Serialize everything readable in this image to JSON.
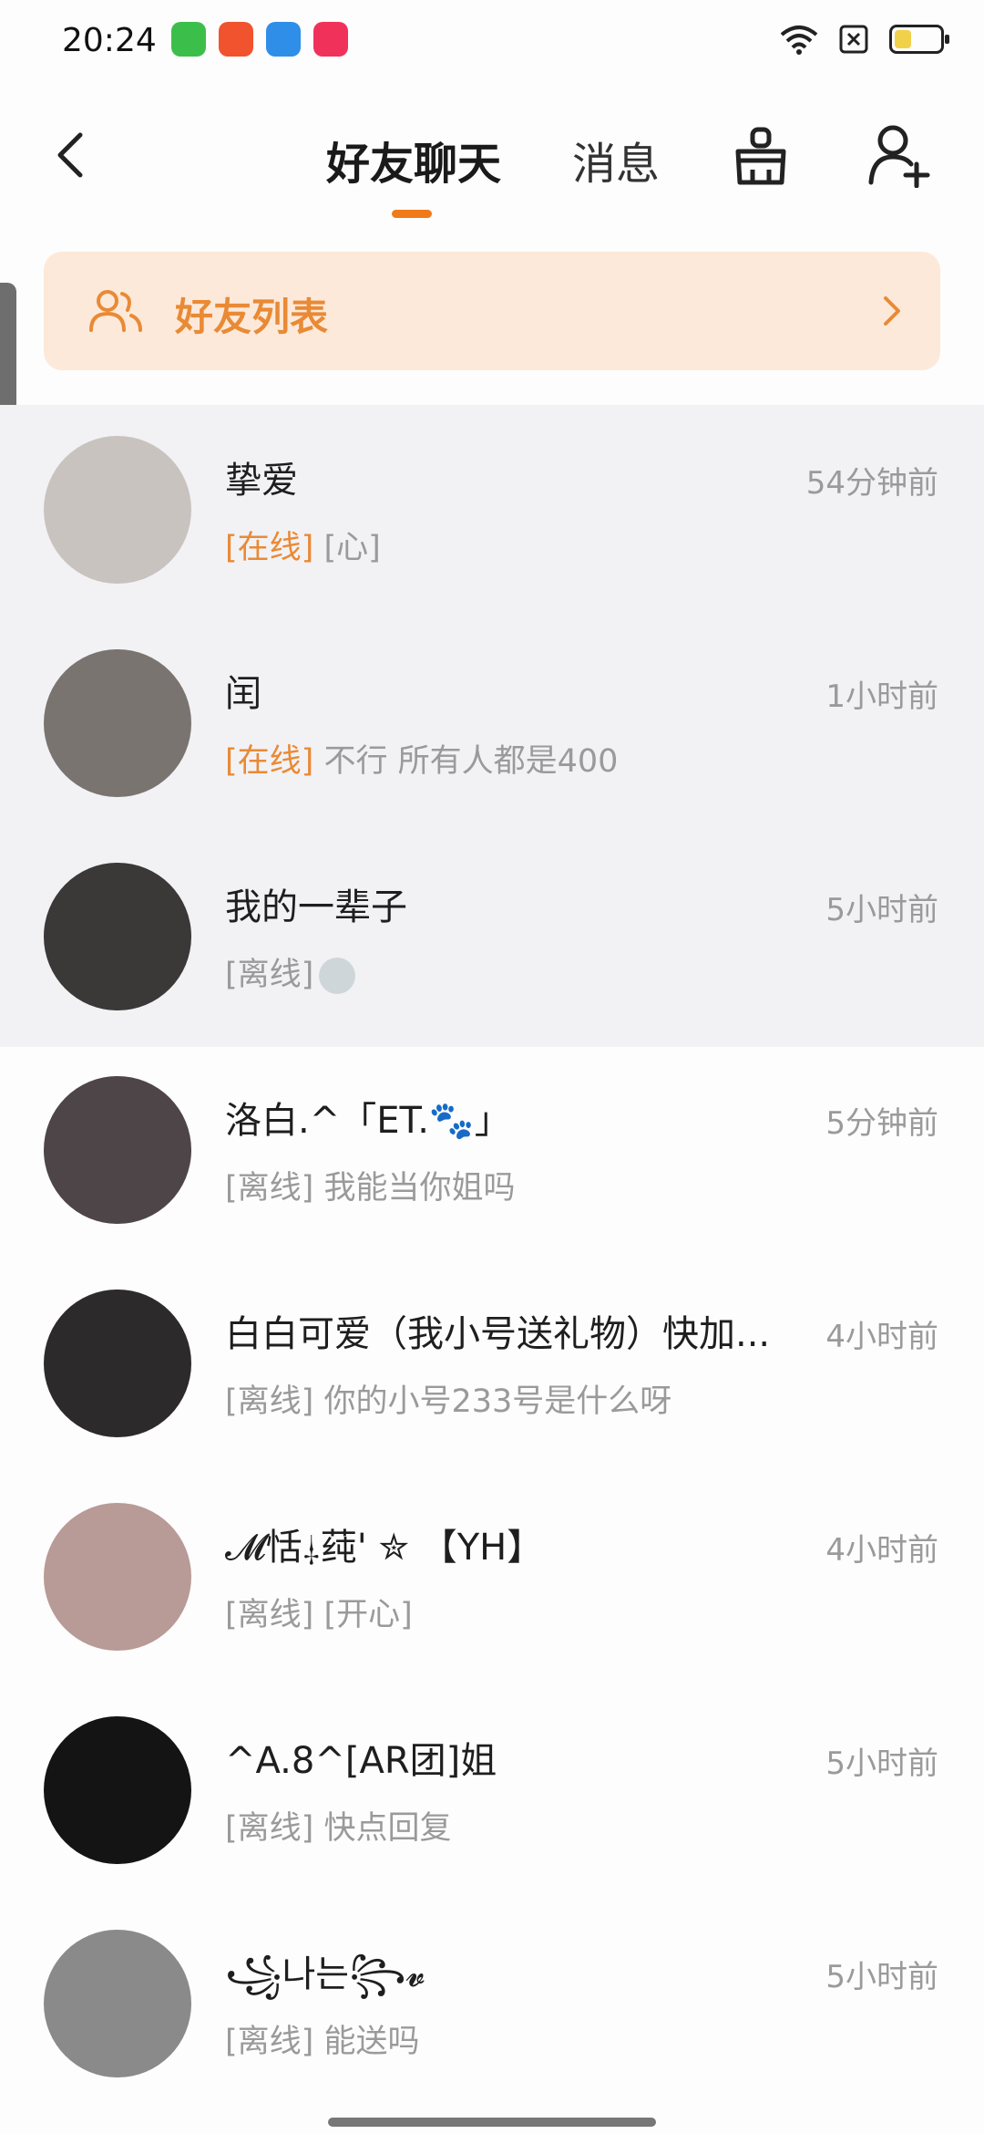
{
  "status_bar": {
    "time": "20:24",
    "app_icons": [
      {
        "name": "green-app-icon",
        "color": "#3cbf4a"
      },
      {
        "name": "video-app-icon",
        "color": "#f0532d"
      },
      {
        "name": "browser-app-icon",
        "color": "#2f8ee8"
      },
      {
        "name": "music-app-icon",
        "color": "#f0325a"
      }
    ],
    "icons": [
      "wifi-icon",
      "sim-off-icon",
      "battery-icon"
    ]
  },
  "header": {
    "tab_active": "好友聊天",
    "tab_messages": "消息"
  },
  "friends_banner": {
    "label": "好友列表"
  },
  "chats": [
    {
      "name": "挚爱",
      "time": "54分钟前",
      "status": "[在线]",
      "online": true,
      "preview": "[心]",
      "avatar_color": "#c9c3c0"
    },
    {
      "name": "闰",
      "time": "1小时前",
      "status": "[在线]",
      "online": true,
      "preview": "不行 所有人都是400",
      "avatar_color": "#7a7470"
    },
    {
      "name": "我的一辈子",
      "time": "5小时前",
      "status": "[离线]",
      "online": false,
      "preview": "",
      "avatar_color": "#3b3838"
    },
    {
      "name": "洛白.^「ET.🐾」",
      "time": "5分钟前",
      "status": "[离线]",
      "online": false,
      "preview": "我能当你姐吗",
      "avatar_color": "#4e4548"
    },
    {
      "name": "白白可爱（我小号送礼物）快加...",
      "time": "4小时前",
      "status": "[离线]",
      "online": false,
      "preview": "你的小号233号是什么呀",
      "avatar_color": "#2d2a2c"
    },
    {
      "name": "𝓜恬⸸莼' ✮ 【YH】",
      "time": "4小时前",
      "status": "[离线]",
      "online": false,
      "preview": "[开心]",
      "avatar_color": "#b89a96"
    },
    {
      "name": "^A.8^[AR团]姐",
      "time": "5小时前",
      "status": "[离线]",
      "online": false,
      "preview": "快点回复",
      "avatar_color": "#141414"
    },
    {
      "name": "꧁나는꧂𝓿",
      "time": "5小时前",
      "status": "[离线]",
      "online": false,
      "preview": "能送吗",
      "avatar_color": "#8a8a8a"
    }
  ],
  "colors": {
    "accent": "#e98a35",
    "tab_indicator": "#f07a1a",
    "banner_bg": "#fde9da",
    "pinned_bg": "#f2f2f5"
  }
}
